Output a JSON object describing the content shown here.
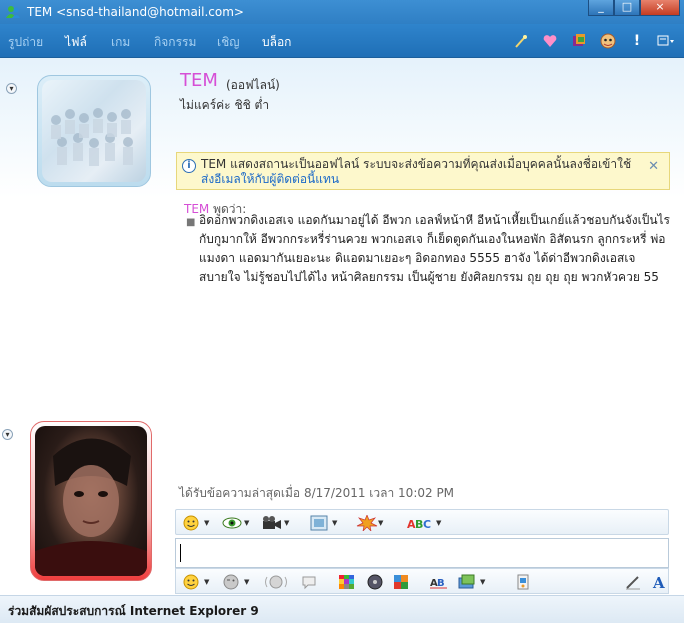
{
  "window": {
    "title": "TEM <snsd-thailand@hotmail.com>",
    "minimize": "_",
    "maximize": "□",
    "close": "×"
  },
  "menu": {
    "items": [
      {
        "label": "รูปถ่าย",
        "active": false
      },
      {
        "label": "ไฟล์",
        "active": true
      },
      {
        "label": "เกม",
        "active": false
      },
      {
        "label": "กิจกรรม",
        "active": false
      },
      {
        "label": "เชิญ",
        "active": false
      },
      {
        "label": "บล็อก",
        "active": true
      }
    ],
    "toolbar_icons": [
      "magic-wand-icon",
      "heart-icon",
      "winks-icon",
      "emoticon-face-icon",
      "nudge-alert-icon",
      "options-menu-icon"
    ]
  },
  "contact": {
    "name": "TEM",
    "status": "(ออฟไลน์)",
    "personal_message": "ไม่แคร์ค่ะ ชิชิ ต่ำ"
  },
  "info_bar": {
    "text": "TEM แสดงสถานะเป็นออฟไลน์ ระบบจะส่งข้อความที่คุณส่งเมื่อบุคคลนั้นลงชื่อเข้าใช้",
    "link": "ส่งอีเมลให้กับผู้ติดต่อนี้แทน"
  },
  "conversation": {
    "sender": "TEM",
    "said": "พูดว่า:",
    "message": "อิดอกพวกดิงเอสเจ แอดกันมาอยู่ได้ อีพวก เอลฟ์หน้าหี อีหน้าเหี้ยเป็นเกย์แล้วชอบกันจังเป็นไรกับกูมากให้ อีพวกกระหรี่ร่านควย พวกเอสเจ ก็เย็ดตูดกันเองในหอพัก อิสัดนรก ลูกกระหรี่ พ่อแมงดา แอดมากันเยอะนะ ดิแอดมาเยอะๆ อิดอกทอง 5555 ฮาจัง ได้ด่าอีพวกดิงเอสเจ สบายใจ ไม่รู้ชอบไปได้ไง หน้าศิลยกรรม เป็นผู้ชาย ยังศิลยกรรม ถุย ถุย ถุย พวกหัวควย 55",
    "last_received": "ได้รับข้อความล่าสุดเมื่อ 8/17/2011 เวลา 10:02 PM"
  },
  "status_bar": {
    "text": "ร่วมสัมผัสประสบการณ์ Internet Explorer 9"
  }
}
